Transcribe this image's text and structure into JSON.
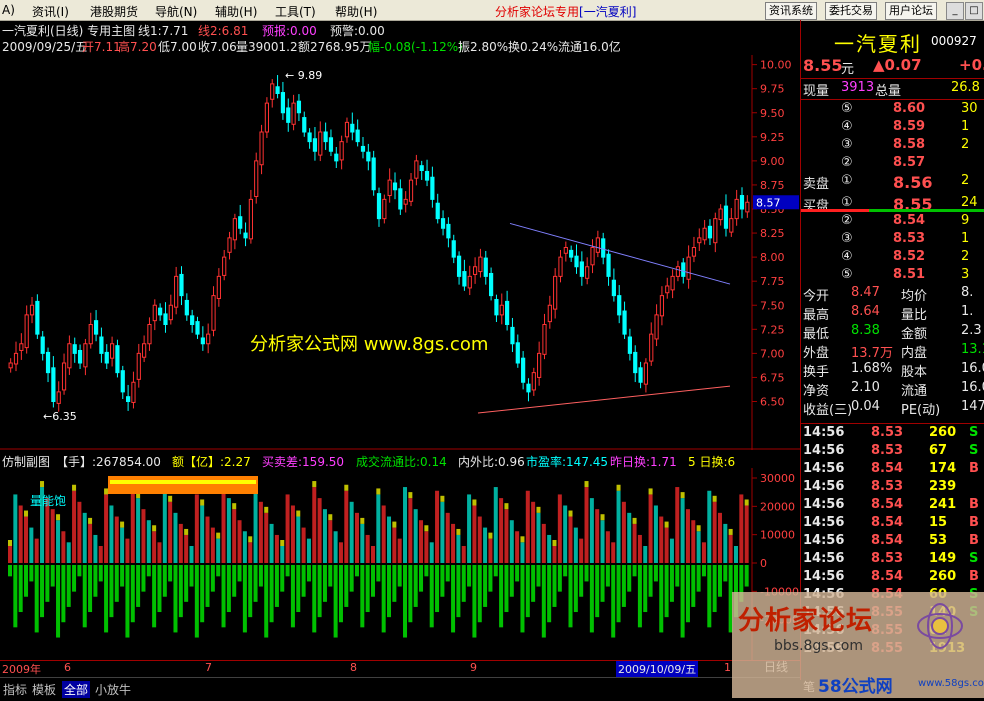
{
  "menu": {
    "items": [
      "A)",
      "资讯(I)",
      "港股期货",
      "导航(N)",
      "辅助(H)",
      "工具(T)",
      "帮助(H)"
    ],
    "title_main": "分析家论坛专用",
    "title_sub": "[一汽夏利]",
    "buttons": [
      "资讯系统",
      "委托交易",
      "用户论坛"
    ],
    "window_icons": [
      "_",
      "□",
      "x"
    ]
  },
  "chart_header": {
    "line1": {
      "name": "一汽夏利(日线) 专用主图",
      "ma1": "线1:7.71",
      "ma2": "线2:6.81",
      "alert": "预报:0.00",
      "warn": "预警:0.00"
    },
    "line2": {
      "date": "2009/09/25/五",
      "open": "开7.11",
      "high": "高7.20",
      "low": "低7.00",
      "close": "收7.06",
      "vol": "量39001.2",
      "amount": "额2768.95万",
      "change": "幅-0.08(-1.12%)",
      "amp": "振2.80%",
      "turnover": "换0.24%",
      "float": "流通16.0亿"
    }
  },
  "chart_data": {
    "type": "candlestick",
    "ylim": [
      6.1,
      10.1
    ],
    "yticks": [
      "10.00",
      "9.75",
      "9.50",
      "9.25",
      "9.00",
      "8.75",
      "8.50",
      "8.25",
      "8.00",
      "7.75",
      "7.50",
      "7.25",
      "7.00",
      "6.75",
      "6.50"
    ],
    "annotations": [
      "9.89",
      "6.35"
    ],
    "current_price_tag": "8.57",
    "watermark": "分析家公式网 www.8gs.com",
    "xlabels": [
      "2009年",
      "6",
      "7",
      "8",
      "9",
      "2009/10/09/五",
      "1"
    ],
    "volume_header": {
      "name": "仿制副图",
      "hands": "【手】:267854.00",
      "amount": "额【亿】:2.27",
      "diff": "买卖差:159.50",
      "ratio": "成交流通比:0.14",
      "inout": "内外比:0.96",
      "pe": "市盈率:147.45",
      "yday": "昨日换:1.71",
      "five": "5 日换:6"
    },
    "volume_label": "量能饱",
    "volume_yticks": [
      "30000",
      "20000",
      "10000",
      "0",
      "-10000",
      "-20000"
    ],
    "closes": [
      6.9,
      7.0,
      7.1,
      7.4,
      7.5,
      7.2,
      7.0,
      6.8,
      6.5,
      6.6,
      6.9,
      7.1,
      7.0,
      6.9,
      7.1,
      7.3,
      7.2,
      7.0,
      6.9,
      7.1,
      6.8,
      6.6,
      6.5,
      6.7,
      7.0,
      7.1,
      7.3,
      7.5,
      7.4,
      7.3,
      7.5,
      7.8,
      7.6,
      7.4,
      7.3,
      7.2,
      7.1,
      7.2,
      7.6,
      7.8,
      8.0,
      8.2,
      8.4,
      8.3,
      8.2,
      8.6,
      9.0,
      9.3,
      9.6,
      9.8,
      9.7,
      9.5,
      9.4,
      9.6,
      9.5,
      9.3,
      9.2,
      9.1,
      9.3,
      9.2,
      9.1,
      9.0,
      9.2,
      9.4,
      9.3,
      9.2,
      9.1,
      9.0,
      8.7,
      8.4,
      8.6,
      8.8,
      8.7,
      8.5,
      8.6,
      8.8,
      9.0,
      8.9,
      8.8,
      8.6,
      8.4,
      8.3,
      8.2,
      8.0,
      7.8,
      7.7,
      7.8,
      7.9,
      8.0,
      7.8,
      7.6,
      7.4,
      7.5,
      7.3,
      7.1,
      6.9,
      6.7,
      6.6,
      6.8,
      7.0,
      7.3,
      7.5,
      7.8,
      8.0,
      8.1,
      8.0,
      7.9,
      7.8,
      7.9,
      8.1,
      8.2,
      8.0,
      7.8,
      7.6,
      7.4,
      7.2,
      7.0,
      6.8,
      6.7,
      6.9,
      7.2,
      7.4,
      7.6,
      7.7,
      7.8,
      7.9,
      7.8,
      8.0,
      8.1,
      8.2,
      8.3,
      8.2,
      8.4,
      8.5,
      8.3,
      8.4,
      8.6,
      8.5,
      8.57
    ]
  },
  "quote": {
    "name": "一汽夏利",
    "code": "000927",
    "price": "8.55",
    "price_unit": "元",
    "change": "▲0.07",
    "change_pct": "+0.",
    "now_vol_label": "现量",
    "now_vol": "3913",
    "total_vol_label": "总量",
    "total_vol": "26.8",
    "sell": [
      {
        "idx": "⑤",
        "price": "8.60",
        "vol": "30"
      },
      {
        "idx": "④",
        "price": "8.59",
        "vol": "1"
      },
      {
        "idx": "③",
        "price": "8.58",
        "vol": "2"
      },
      {
        "idx": "②",
        "price": "8.57",
        "vol": ""
      },
      {
        "idx": "①",
        "price": "8.56",
        "vol": "2",
        "label": "卖盘"
      }
    ],
    "buy": [
      {
        "idx": "①",
        "price": "8.55",
        "vol": "24",
        "label": "买盘"
      },
      {
        "idx": "②",
        "price": "8.54",
        "vol": "9"
      },
      {
        "idx": "③",
        "price": "8.53",
        "vol": "1"
      },
      {
        "idx": "④",
        "price": "8.52",
        "vol": "2"
      },
      {
        "idx": "⑤",
        "price": "8.51",
        "vol": "3"
      }
    ],
    "stats": [
      {
        "l1": "今开",
        "v1": "8.47",
        "l2": "均价",
        "v2": "8."
      },
      {
        "l1": "最高",
        "v1": "8.64",
        "l2": "量比",
        "v2": "1."
      },
      {
        "l1": "最低",
        "v1": "8.38",
        "l2": "金额",
        "v2": "2.3"
      },
      {
        "l1": "外盘",
        "v1": "13.7万",
        "l2": "内盘",
        "v2": "13.1"
      },
      {
        "l1": "换手",
        "v1": "1.68%",
        "l2": "股本",
        "v2": "16.0"
      },
      {
        "l1": "净资",
        "v1": "2.10",
        "l2": "流通",
        "v2": "16.0"
      },
      {
        "l1": "收益(三)",
        "v1": "0.04",
        "l2": "PE(动)",
        "v2": "147"
      }
    ],
    "ticks": [
      {
        "t": "14:56",
        "p": "8.53",
        "v": "260",
        "s": "S"
      },
      {
        "t": "14:56",
        "p": "8.53",
        "v": "67",
        "s": "S"
      },
      {
        "t": "14:56",
        "p": "8.54",
        "v": "174",
        "s": "B"
      },
      {
        "t": "14:56",
        "p": "8.53",
        "v": "239",
        "s": ""
      },
      {
        "t": "14:56",
        "p": "8.54",
        "v": "241",
        "s": "B"
      },
      {
        "t": "14:56",
        "p": "8.54",
        "v": "15",
        "s": "B"
      },
      {
        "t": "14:56",
        "p": "8.54",
        "v": "53",
        "s": "B"
      },
      {
        "t": "14:56",
        "p": "8.53",
        "v": "149",
        "s": "S"
      },
      {
        "t": "14:56",
        "p": "8.54",
        "v": "260",
        "s": "B"
      },
      {
        "t": "14:56",
        "p": "8.54",
        "v": "60",
        "s": "S"
      },
      {
        "t": "14:56",
        "p": "8.55",
        "v": "140",
        "s": "S"
      },
      {
        "t": "14:56",
        "p": "8.55",
        "v": "62",
        "s": ""
      },
      {
        "t": "14:56",
        "p": "8.55",
        "v": "1913",
        "s": ""
      }
    ],
    "period_label": "日线",
    "bottom_label": "笔"
  },
  "bottom_tabs": [
    "指标",
    "模板",
    "全部",
    "小放牛"
  ],
  "logo": {
    "text": "分析家论坛",
    "url": "bbs.8gs.com",
    "brand": "58公式网",
    "brand_url": "www.58gs.com"
  }
}
